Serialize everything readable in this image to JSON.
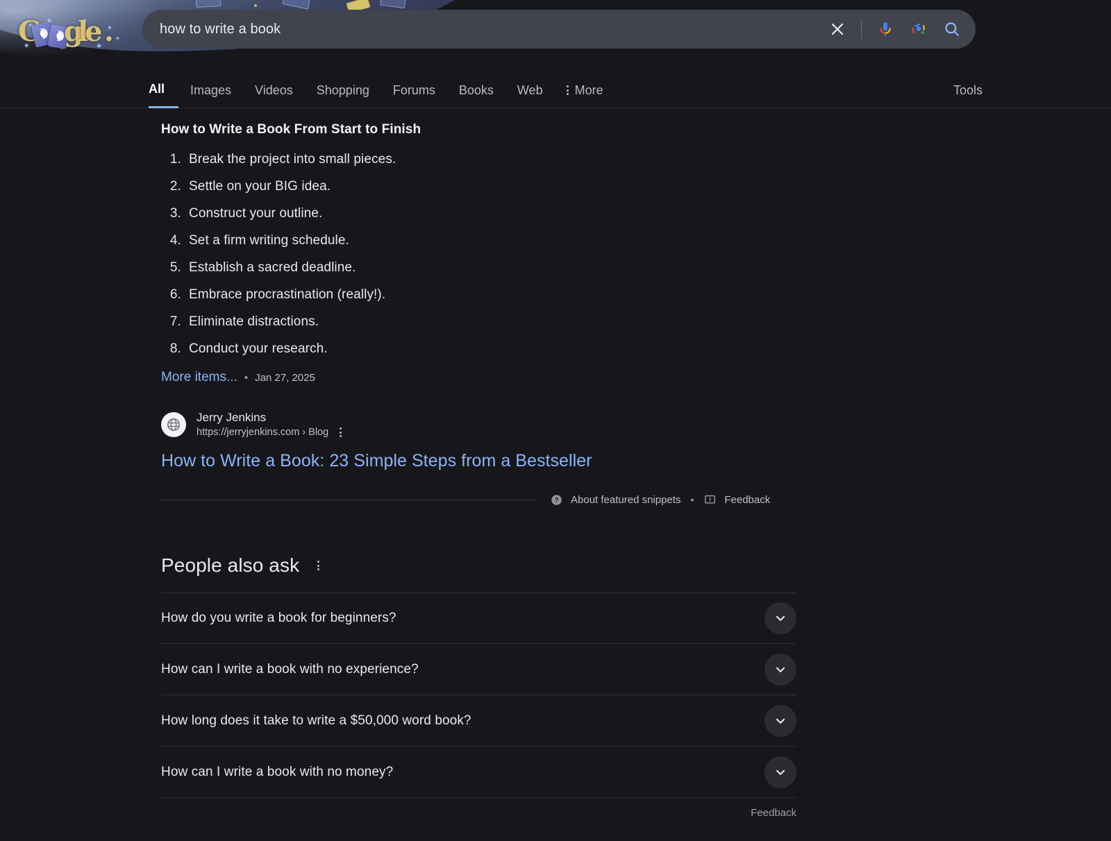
{
  "doodle": {
    "logo_text": "Google",
    "letters": [
      "G",
      "g",
      "l",
      "e",
      "."
    ],
    "alt": "google-doodle-moon-cards"
  },
  "search": {
    "query": "how to write a book",
    "placeholder": "Search",
    "clear_icon": "close-icon",
    "voice_icon": "microphone-icon",
    "lens_icon": "google-lens-icon",
    "search_icon": "search-icon"
  },
  "nav": {
    "tabs": [
      {
        "label": "All",
        "active": true
      },
      {
        "label": "Images",
        "active": false
      },
      {
        "label": "Videos",
        "active": false
      },
      {
        "label": "Shopping",
        "active": false
      },
      {
        "label": "Forums",
        "active": false
      },
      {
        "label": "Books",
        "active": false
      },
      {
        "label": "Web",
        "active": false
      }
    ],
    "more_label": "More",
    "tools_label": "Tools"
  },
  "featured_snippet": {
    "title": "How to Write a Book From Start to Finish",
    "steps": [
      "Break the project into small pieces.",
      "Settle on your BIG idea.",
      "Construct your outline.",
      "Set a firm writing schedule.",
      "Establish a sacred deadline.",
      "Embrace procrastination (really!).",
      "Eliminate distractions.",
      "Conduct your research."
    ],
    "more_items_label": "More items...",
    "separator": "•",
    "date": "Jan 27, 2025",
    "source": {
      "name": "Jerry Jenkins",
      "url": "https://jerryjenkins.com › Blog",
      "favicon_icon": "globe-icon",
      "menu_icon": "more-options-icon"
    },
    "result_title": "How to Write a Book: 23 Simple Steps from a Bestseller",
    "footer": {
      "about_label": "About featured snippets",
      "about_icon": "help-circle-icon",
      "separator": "•",
      "feedback_label": "Feedback",
      "feedback_icon": "report-flag-icon"
    }
  },
  "people_also_ask": {
    "heading": "People also ask",
    "menu_icon": "more-options-icon",
    "questions": [
      "How do you write a book for beginners?",
      "How can I write a book with no experience?",
      "How long does it take to write a $50,000 word book?",
      "How can I write a book with no money?"
    ],
    "expand_icon": "chevron-down-icon",
    "feedback_label": "Feedback"
  },
  "colors": {
    "page_bg": "#17171b",
    "link_blue": "#8ab4f8",
    "text_primary": "#e8eaed",
    "text_secondary": "#bdc1c6",
    "search_bg": "#41444d",
    "doodle_gold": "#d9c278"
  }
}
